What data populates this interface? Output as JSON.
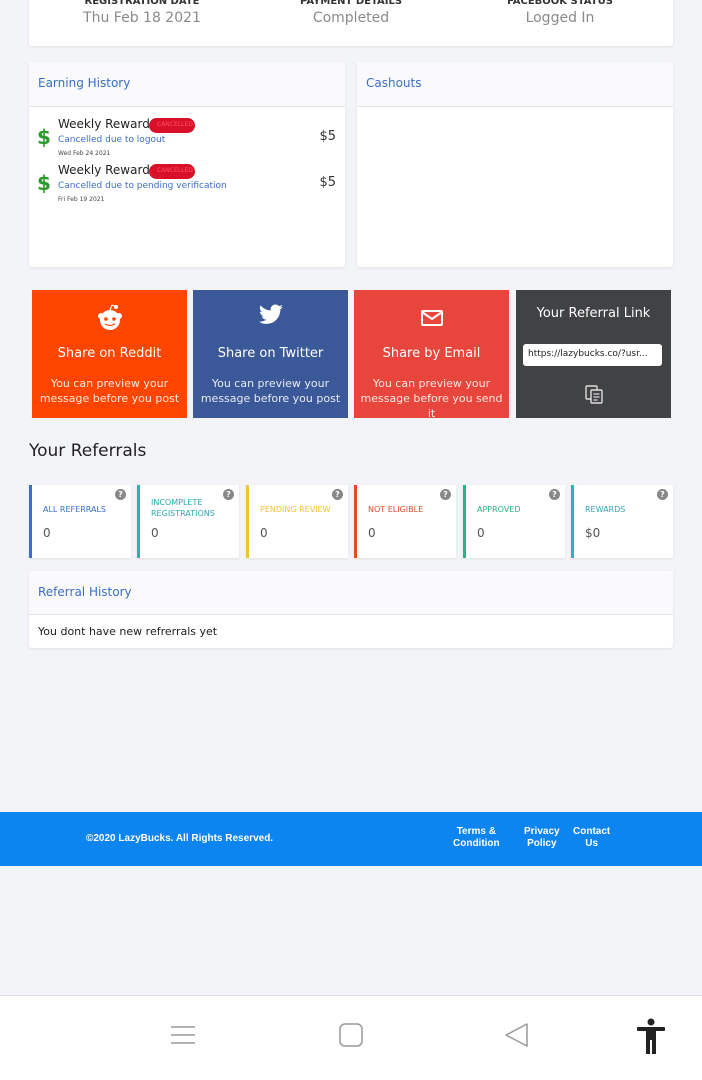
{
  "top_info": [
    {
      "label": "REGISTRATION DATE",
      "value": "Thu Feb 18 2021"
    },
    {
      "label": "PAYMENT DETAILS",
      "value": "Completed"
    },
    {
      "label": "FACEBOOK STATUS",
      "value": "Logged In"
    }
  ],
  "earning_history": {
    "title": "Earning History",
    "items": [
      {
        "title": "Weekly Reward",
        "badge": "CANCELLED",
        "reason": "Cancelled due to logout",
        "date": "Wed Feb 24 2021",
        "amount": "$5"
      },
      {
        "title": "Weekly Reward",
        "badge": "CANCELLED",
        "reason": "Cancelled due to pending verification",
        "date": "Fri Feb 19 2021",
        "amount": "$5"
      }
    ]
  },
  "cashouts": {
    "title": "Cashouts"
  },
  "share": {
    "reddit": {
      "title": "Share on Reddit",
      "desc": "You can preview your message before you post"
    },
    "twitter": {
      "title": "Share on Twitter",
      "desc": "You can preview your message before you post"
    },
    "email": {
      "title": "Share by Email",
      "desc": "You can preview your message before you send it"
    },
    "referral": {
      "title": "Your Referral Link",
      "link": "https://lazybucks.co/?usr..."
    }
  },
  "referrals": {
    "title": "Your Referrals",
    "stats": [
      {
        "label": "ALL REFERRALS",
        "value": "0"
      },
      {
        "label": "INCOMPLETE REGISTRATIONS",
        "value": "0"
      },
      {
        "label": "PENDING REVIEW",
        "value": "0"
      },
      {
        "label": "NOT ELIGIBLE",
        "value": "0"
      },
      {
        "label": "APPROVED",
        "value": "0"
      },
      {
        "label": "REWARDS",
        "value": "$0"
      }
    ],
    "help": "?"
  },
  "referral_history": {
    "title": "Referral History",
    "empty": "You dont have new refrerrals yet"
  },
  "footer": {
    "copyright": "©2020 LazyBucks. All Rights Reserved.",
    "terms": [
      "Terms &",
      "Condition"
    ],
    "privacy": [
      "Privacy",
      "Policy"
    ],
    "contact": [
      "Contact",
      "Us"
    ]
  },
  "colors": {
    "accent": "#0d85f0",
    "reddit": "#ff4500",
    "twitter": "#3b5998",
    "email": "#e8453c",
    "dark": "#414244"
  }
}
